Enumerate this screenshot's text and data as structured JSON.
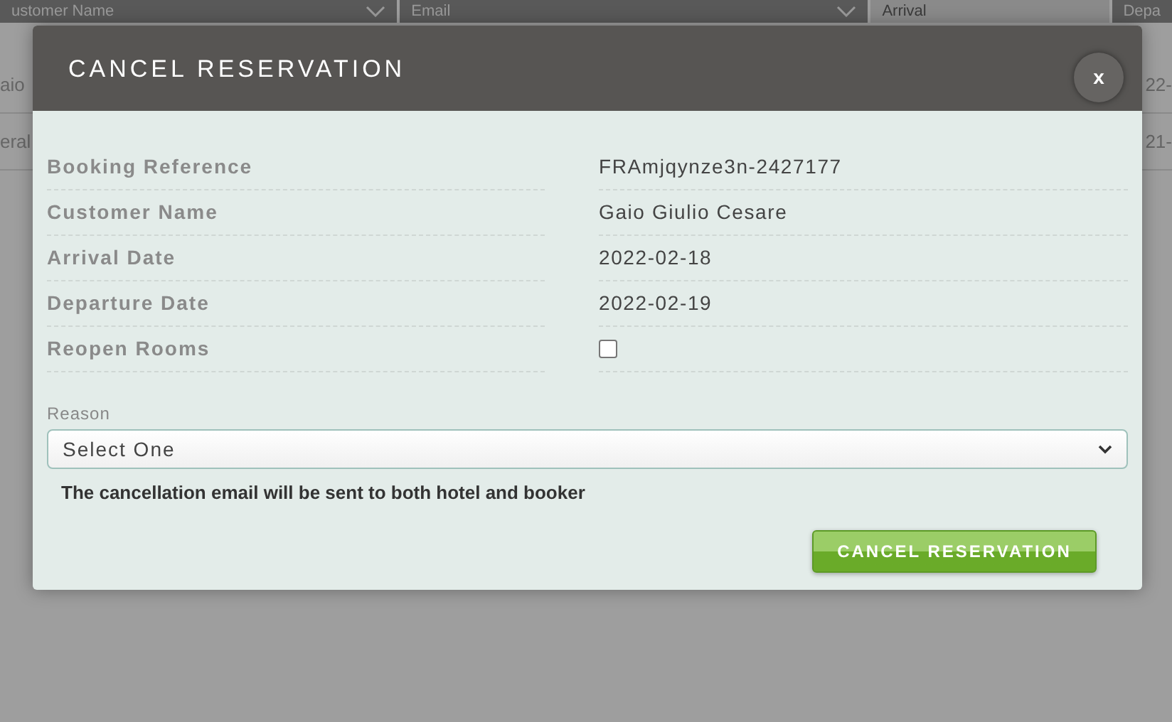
{
  "background_table": {
    "columns": [
      "ustomer Name",
      "Email",
      "Arrival",
      "Depa"
    ],
    "rows": [
      {
        "cells": [
          "aio",
          "22-"
        ]
      },
      {
        "cells": [
          "eral",
          "21-"
        ]
      }
    ]
  },
  "modal": {
    "title": "CANCEL RESERVATION",
    "close": "x",
    "fields": [
      {
        "kind": "text",
        "label": "Booking Reference",
        "value": "FRAmjqynze3n-2427177"
      },
      {
        "kind": "text",
        "label": "Customer Name",
        "value": "Gaio Giulio Cesare"
      },
      {
        "kind": "text",
        "label": "Arrival Date",
        "value": "2022-02-18"
      },
      {
        "kind": "text",
        "label": "Departure Date",
        "value": "2022-02-19"
      },
      {
        "kind": "checkbox",
        "label": "Reopen Rooms",
        "checked": false
      }
    ],
    "reason": {
      "label": "Reason",
      "value": "Select One"
    },
    "note": "The cancellation email will be sent to both hotel and booker",
    "button": "CANCEL RESERVATION"
  }
}
